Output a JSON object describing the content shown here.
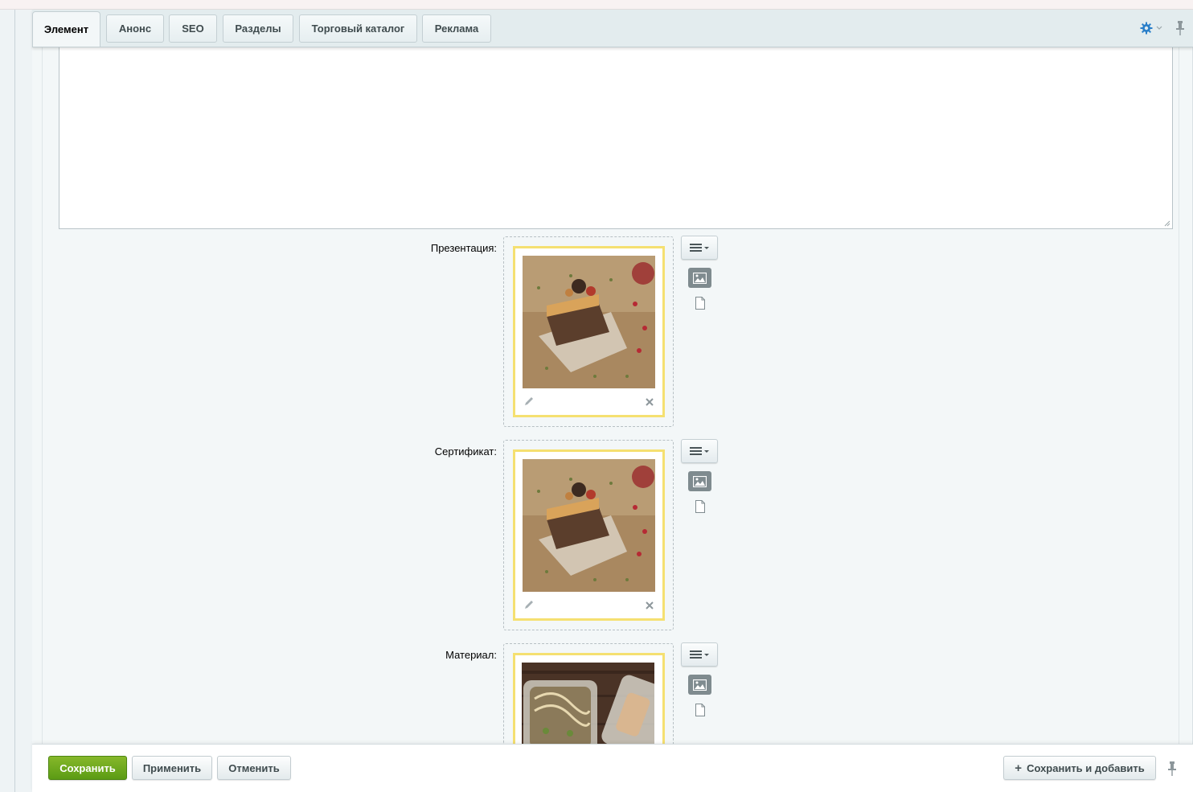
{
  "tabs": [
    {
      "label": "Элемент",
      "active": true
    },
    {
      "label": "Анонс"
    },
    {
      "label": "SEO"
    },
    {
      "label": "Разделы"
    },
    {
      "label": "Торговый каталог"
    },
    {
      "label": "Реклама"
    }
  ],
  "tab_actions": {
    "settings_icon": "gear-icon",
    "pin_icon": "pin-icon"
  },
  "fields": [
    {
      "label": "Презентация:",
      "image": "cake-slice-photo"
    },
    {
      "label": "Сертификат:",
      "image": "cake-slice-photo"
    },
    {
      "label": "Материал:",
      "image": "food-containers-photo"
    }
  ],
  "file_controls": {
    "menu_icon": "menu-lines-icon",
    "image_icon": "image-icon",
    "document_icon": "document-icon",
    "edit_icon": "pencil-icon",
    "delete_icon": "close-icon"
  },
  "footer": {
    "save_label": "Сохранить",
    "apply_label": "Применить",
    "cancel_label": "Отменить",
    "save_add_label": "Сохранить и добавить"
  },
  "colors": {
    "accent_green": "#6aa81c",
    "card_border": "#f5e071",
    "gear_blue": "#2a7fc9"
  }
}
